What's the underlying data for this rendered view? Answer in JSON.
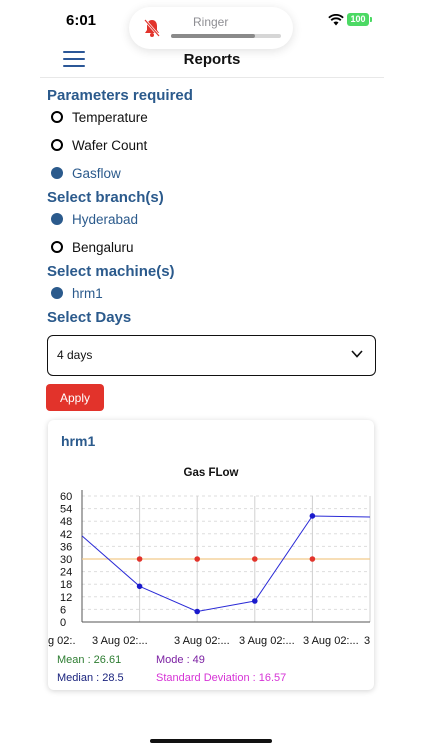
{
  "status": {
    "time": "6:01",
    "ringer_label": "Ringer",
    "ringer_level": 0.76,
    "battery": "100",
    "colors": {
      "battery": "#4cd964",
      "bell": "#e2332b"
    }
  },
  "header": {
    "title": "Reports",
    "menu_icon": "hamburger-menu-icon"
  },
  "parameters": {
    "title": "Parameters required",
    "options": [
      {
        "label": "Temperature",
        "selected": false
      },
      {
        "label": "Wafer Count",
        "selected": false
      },
      {
        "label": "Gasflow",
        "selected": true
      }
    ]
  },
  "branches": {
    "title": "Select branch(s)",
    "options": [
      {
        "label": "Hyderabad",
        "selected": true
      },
      {
        "label": "Bengaluru",
        "selected": false
      }
    ]
  },
  "machines": {
    "title": "Select machine(s)",
    "options": [
      {
        "label": "hrm1",
        "selected": true
      }
    ]
  },
  "days": {
    "title": "Select Days",
    "selected": "4 days"
  },
  "apply_label": "Apply",
  "card": {
    "title": "hrm1",
    "stats": {
      "mean": "Mean : 26.61",
      "mode": "Mode : 49",
      "median": "Median : 28.5",
      "std": "Standard Deviation : 16.57"
    }
  },
  "colors": {
    "accent": "#2b5a8c",
    "apply": "#e2332b",
    "series_line": "#2a2ad6",
    "reference_line": "#f2c98a",
    "reference_points": "#e2332b",
    "mean_text": "#2e7d32",
    "mode_text": "#7b1fa2",
    "median_text": "#1a237e",
    "std_text": "#d633d6"
  },
  "chart_data": {
    "type": "line",
    "title": "Gas FLow",
    "xlabel": "",
    "ylabel": "",
    "ylim": [
      0,
      60
    ],
    "yticks": [
      0,
      6,
      12,
      18,
      24,
      30,
      36,
      42,
      48,
      54,
      60
    ],
    "x_tick_labels": [
      "g 02:.",
      "3 Aug 02:...",
      "3 Aug 02:...",
      "3 Aug 02:...",
      "3 Aug 02:...",
      "3"
    ],
    "grid": true,
    "series": [
      {
        "values": [
          41,
          17,
          5,
          10,
          50.5,
          50
        ]
      }
    ],
    "reference_line": {
      "value": 30
    }
  }
}
